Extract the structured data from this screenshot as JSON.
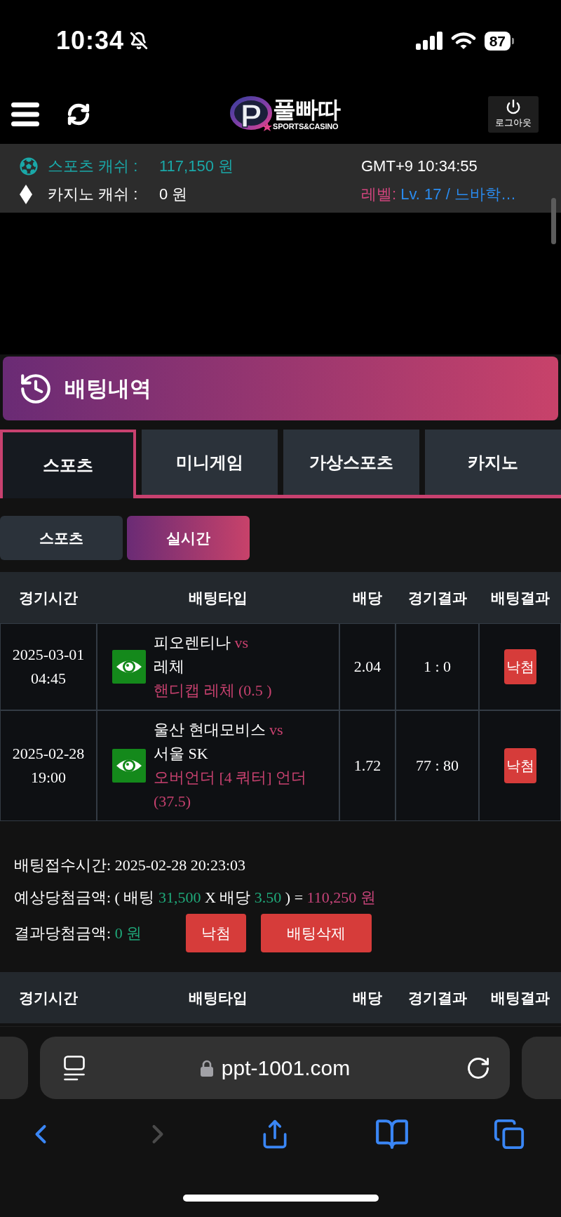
{
  "status_bar": {
    "time": "10:34",
    "muted": true,
    "battery": "87"
  },
  "header": {
    "logo": {
      "letter": "P",
      "wordmark": "풀빠따",
      "tagline": "SPORTS&CASINO"
    },
    "logout": "로그아웃"
  },
  "wallet": {
    "items": [
      {
        "kind": "sports",
        "label": "스포츠 캐쉬 :",
        "value": "117,150 원",
        "color": "#1aa8a8"
      },
      {
        "kind": "casino",
        "label": "카지노 캐쉬 :",
        "value": "0 원",
        "color": "#ffffff"
      }
    ],
    "clock": "GMT+9 10:34:55",
    "level": {
      "label": "레벨:",
      "value": "Lv. 17 / 느바학…"
    }
  },
  "page_title": "배팅내역",
  "tabs": [
    {
      "label": "스포츠",
      "selected": true
    },
    {
      "label": "미니게임",
      "selected": false
    },
    {
      "label": "가상스포츠",
      "selected": false
    },
    {
      "label": "카지노",
      "selected": false
    }
  ],
  "sub_tabs": [
    {
      "label": "스포츠",
      "selected": false
    },
    {
      "label": "실시간",
      "selected": true
    }
  ],
  "bet_slips": [
    {
      "columns": [
        "경기시간",
        "배팅타입",
        "배당",
        "경기결과",
        "배팅결과"
      ],
      "rows": [
        {
          "time": "2025-03-01 04:45",
          "home": "피오렌티나",
          "versus": "vs",
          "away": "레체",
          "pick": "핸디캡 레체 (0.5 )",
          "odds": "2.04",
          "score": "1 : 0",
          "result": "낙첨"
        },
        {
          "time": "2025-02-28 19:00",
          "home": "울산 현대모비스",
          "versus": "vs",
          "away": "서울 SK",
          "pick": "오버언더 [4 쿼터] 언더 (37.5)",
          "odds": "1.72",
          "score": "77 : 80",
          "result": "낙첨"
        }
      ],
      "summary": {
        "received": [
          {
            "text": "배팅접수시간:",
            "color": "#ffffff"
          },
          {
            "text": "2025-02-28 20:23:03",
            "color": "#ffffff"
          }
        ],
        "expected": [
          {
            "text": "예상당첨금액: ( 배팅",
            "color": "#ffffff"
          },
          {
            "text": "31,500",
            "color": "#1fa97a"
          },
          {
            "text": "X 배당",
            "color": "#ffffff"
          },
          {
            "text": "3.50",
            "color": "#1fa97a"
          },
          {
            "text": ") =",
            "color": "#ffffff"
          },
          {
            "text": "110,250 원",
            "color": "#c8447a"
          }
        ],
        "settled": [
          {
            "text": "결과당첨금액:",
            "color": "#ffffff"
          },
          {
            "text": "0 원",
            "color": "#1fa97a"
          }
        ],
        "buttons": [
          {
            "label": "낙첨",
            "kind": "status"
          },
          {
            "label": "배팅삭제",
            "kind": "delete"
          }
        ]
      }
    },
    {
      "columns": [
        "경기시간",
        "배팅타입",
        "배당",
        "경기결과",
        "배팅결과"
      ]
    }
  ],
  "browser": {
    "url": "ppt-1001.com",
    "back_enabled": true,
    "forward_enabled": false
  }
}
